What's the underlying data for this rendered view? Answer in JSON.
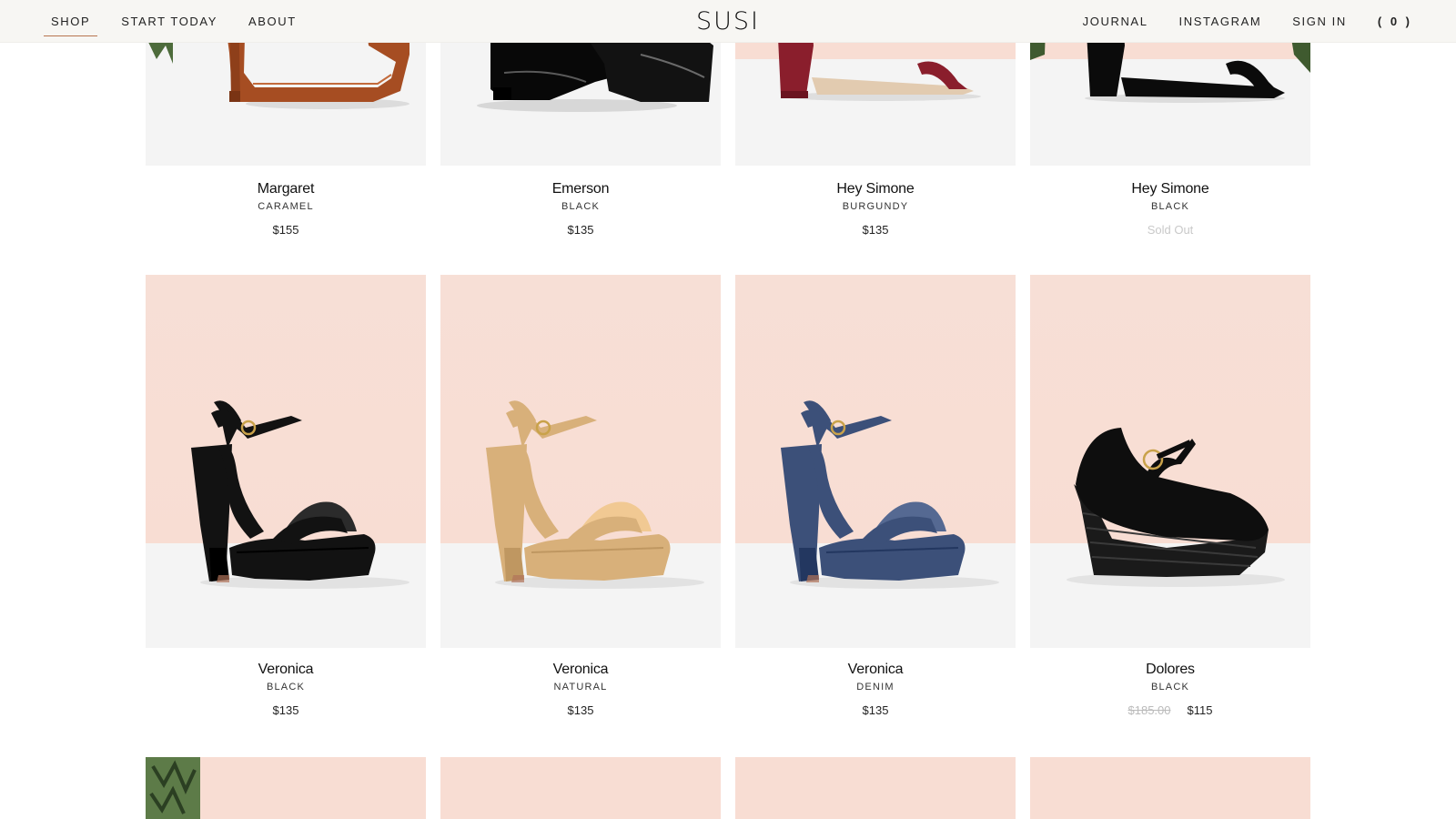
{
  "header": {
    "logo": "SUSI",
    "left_nav": [
      {
        "label": "SHOP",
        "active": true
      },
      {
        "label": "START TODAY",
        "active": false
      },
      {
        "label": "ABOUT",
        "active": false
      }
    ],
    "right_nav": [
      {
        "label": "JOURNAL"
      },
      {
        "label": "INSTAGRAM"
      },
      {
        "label": "SIGN IN"
      }
    ],
    "cart_label": "( 0 )"
  },
  "products": {
    "row1": [
      {
        "name": "Margaret",
        "color": "CARAMEL",
        "price": "$155",
        "shoe": "caramel-boot-icon"
      },
      {
        "name": "Emerson",
        "color": "BLACK",
        "price": "$135",
        "shoe": "black-oxford-icon"
      },
      {
        "name": "Hey Simone",
        "color": "BURGUNDY",
        "price": "$135",
        "shoe": "burgundy-heel-icon"
      },
      {
        "name": "Hey Simone",
        "color": "BLACK",
        "price": "Sold Out",
        "shoe": "black-heel-icon"
      }
    ],
    "row2": [
      {
        "name": "Veronica",
        "color": "BLACK",
        "price": "$135",
        "shoe": "black-platform-sandal-icon",
        "shoe_color": "#121212"
      },
      {
        "name": "Veronica",
        "color": "NATURAL",
        "price": "$135",
        "shoe": "natural-platform-sandal-icon",
        "shoe_color": "#d8b07a"
      },
      {
        "name": "Veronica",
        "color": "DENIM",
        "price": "$135",
        "shoe": "denim-platform-sandal-icon",
        "shoe_color": "#3c5079"
      },
      {
        "name": "Dolores",
        "color": "BLACK",
        "old_price": "$185.00",
        "price": "$115",
        "shoe": "black-espadrille-wedge-icon"
      }
    ]
  },
  "colors": {
    "header_bg": "#f7f6f3",
    "image_pink": "#f8ddd3",
    "image_floor": "#f4f4f4",
    "active_underline": "#b7754f",
    "sold_out": "#c9c9c9",
    "strike_price": "#bbbbbb"
  }
}
